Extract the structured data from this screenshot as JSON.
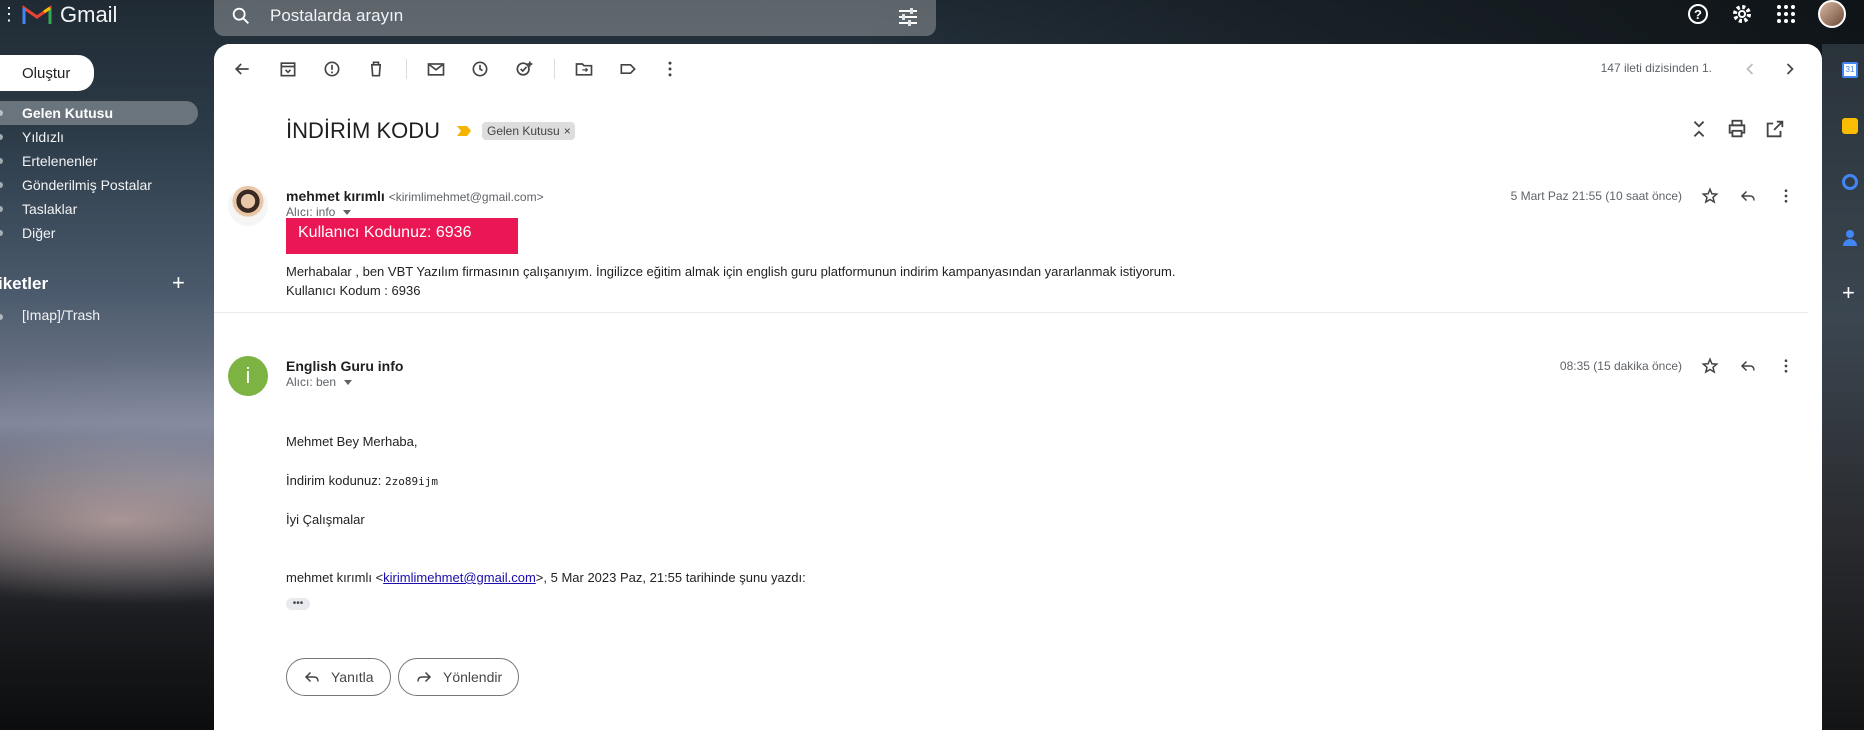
{
  "app": {
    "name": "Gmail"
  },
  "search": {
    "placeholder": "Postalarda arayın"
  },
  "sidebar": {
    "compose": "Oluştur",
    "items": [
      {
        "label": "Gelen Kutusu",
        "active": true
      },
      {
        "label": "Yıldızlı"
      },
      {
        "label": "Ertelenenler"
      },
      {
        "label": "Gönderilmiş Postalar"
      },
      {
        "label": "Taslaklar"
      },
      {
        "label": "Diğer"
      }
    ],
    "labels_heading": "iketler",
    "labels": [
      {
        "label": "[Imap]/Trash"
      }
    ]
  },
  "toolbar": {
    "pager": "147 ileti dizisinden 1."
  },
  "thread": {
    "subject": "İNDİRİM KODU",
    "chip": "Gelen Kutusu",
    "messages": [
      {
        "sender": "mehmet kırımlı",
        "email": "<kirimlimehmet@gmail.com>",
        "to": "Alıcı: info",
        "date": "5 Mart Paz 21:55 (10 saat önce)",
        "banner": "Kullanıcı Kodunuz: 6936",
        "line1": "Merhabalar , ben VBT Yazılım firmasının çalışanıyım. İngilizce eğitim almak için english guru platformunun indirim kampanyasından yararlanmak istiyorum.",
        "line2": "Kullanıcı Kodum : 6936"
      },
      {
        "sender": "English Guru info",
        "avatar_letter": "i",
        "to": "Alıcı: ben",
        "date": "08:35 (15 dakika önce)",
        "greeting": "Mehmet Bey Merhaba,",
        "code_label": "İndirim kodunuz: ",
        "code": "2zo89ijm",
        "closing": "İyi Çalışmalar",
        "quote_prefix": "mehmet kırımlı <",
        "quote_link": "kirimlimehmet@gmail.com",
        "quote_suffix": ">, 5 Mar 2023 Paz, 21:55 tarihinde şunu yazdı:",
        "ellipsis": "•••"
      }
    ]
  },
  "actions": {
    "reply": "Yanıtla",
    "forward": "Yönlendir"
  },
  "colors": {
    "accent_red": "#eb1654",
    "avatar_green": "#7cb342",
    "link": "#1a0dab"
  }
}
